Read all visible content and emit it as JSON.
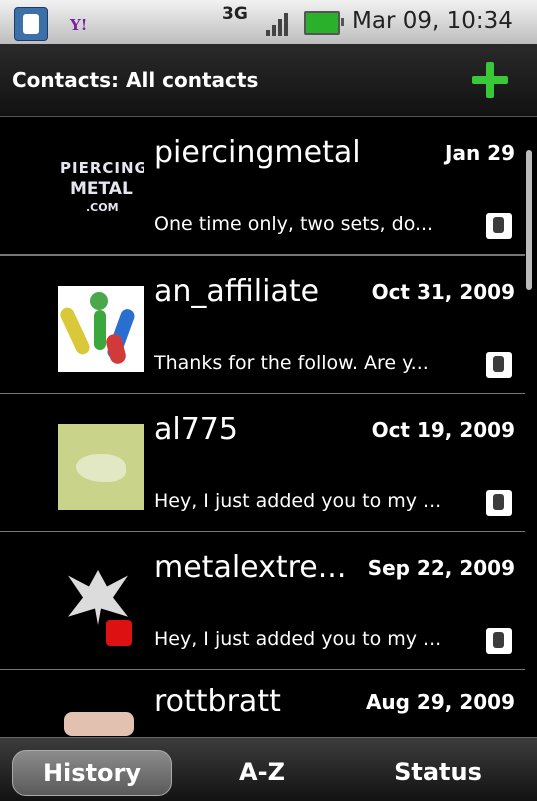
{
  "status_bar": {
    "network": "3G",
    "clock": "Mar 09, 10:34",
    "yahoo": "Y!"
  },
  "header": {
    "title": "Contacts: All contacts"
  },
  "contacts": [
    {
      "name": "piercingmetal",
      "date": "Jan 29",
      "message": "One time only, two sets, do...",
      "avatar": {
        "line1": "PIERCING",
        "line2": "METAL",
        "line3": ".COM"
      }
    },
    {
      "name": "an_affiliate",
      "date": "Oct 31, 2009",
      "message": "Thanks for the follow. Are y..."
    },
    {
      "name": "al775",
      "date": "Oct 19, 2009",
      "message": "Hey, I just added you to my ..."
    },
    {
      "name": "metalextre...",
      "date": "Sep 22, 2009",
      "message": "Hey, I just added you to my ..."
    },
    {
      "name": "rottbratt",
      "date": "Aug 29, 2009",
      "message": ""
    }
  ],
  "tabs": [
    {
      "label": "History"
    },
    {
      "label": "A-Z"
    },
    {
      "label": "Status"
    }
  ],
  "colors": {
    "accent_green": "#38c838",
    "battery": "#2bb02b"
  }
}
